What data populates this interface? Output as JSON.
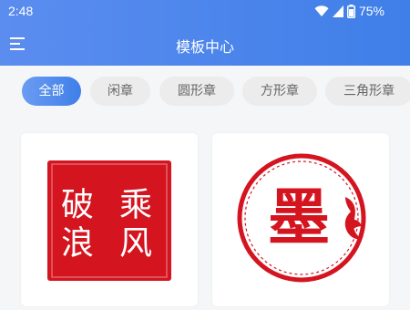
{
  "status_bar": {
    "time": "2:48",
    "battery": "75%",
    "icons": [
      "wifi-icon",
      "signal-icon",
      "battery-icon"
    ]
  },
  "toolbar": {
    "menu_icon": "menu-icon",
    "title": "模板中心"
  },
  "tabs": [
    {
      "label": "全部",
      "active": true
    },
    {
      "label": "闲章",
      "active": false
    },
    {
      "label": "圆形章",
      "active": false
    },
    {
      "label": "方形章",
      "active": false
    },
    {
      "label": "三角形章",
      "active": false
    }
  ],
  "templates": [
    {
      "shape": "square",
      "text": [
        "破",
        "乘",
        "浪",
        "风"
      ],
      "color": "#d4141f"
    },
    {
      "shape": "circle",
      "text": "墨",
      "color": "#d4141f"
    }
  ],
  "colors": {
    "accent": "#3f7fe8",
    "seal_red": "#d4141f"
  }
}
